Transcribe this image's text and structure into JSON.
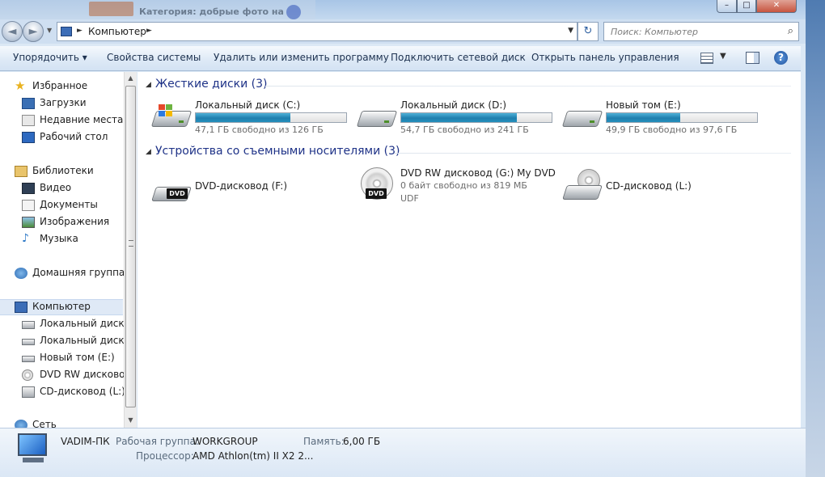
{
  "window": {
    "title_ghost": "Категория: добрые фото на",
    "minimize": "–",
    "maximize": "□",
    "close": "✕"
  },
  "nav": {
    "back": "◄",
    "forward": "►",
    "history": "▼",
    "address": "Компьютер",
    "refresh": "↻",
    "search_placeholder": "Поиск: Компьютер"
  },
  "commands": {
    "organize": "Упорядочить ▾",
    "system_props": "Свойства системы",
    "uninstall": "Удалить или изменить программу",
    "map_drive": "Подключить сетевой диск",
    "control_panel": "Открыть панель управления"
  },
  "navpane": {
    "items": [
      {
        "label": "Избранное"
      },
      {
        "label": "Загрузки"
      },
      {
        "label": "Недавние места"
      },
      {
        "label": "Рабочий стол"
      },
      {
        "label": "Библиотеки"
      },
      {
        "label": "Видео"
      },
      {
        "label": "Документы"
      },
      {
        "label": "Изображения"
      },
      {
        "label": "Музыка"
      },
      {
        "label": "Домашняя группа"
      },
      {
        "label": "Компьютер"
      },
      {
        "label": "Локальный диск (C"
      },
      {
        "label": "Локальный диск (D"
      },
      {
        "label": "Новый том (E:)"
      },
      {
        "label": "DVD RW дисковод ("
      },
      {
        "label": "CD-дисковод (L:)"
      },
      {
        "label": "Сеть"
      }
    ]
  },
  "content": {
    "hdd_group": "Жесткие диски (3)",
    "removable_group": "Устройства со съемными носителями (3)",
    "hdds": [
      {
        "name": "Локальный диск (C:)",
        "free": "47,1 ГБ свободно из 126 ГБ",
        "used_fraction": 0.63
      },
      {
        "name": "Локальный диск (D:)",
        "free": "54,7 ГБ свободно из 241 ГБ",
        "used_fraction": 0.77
      },
      {
        "name": "Новый том (E:)",
        "free": "49,9 ГБ свободно из 97,6 ГБ",
        "used_fraction": 0.49
      }
    ],
    "removables": [
      {
        "name": "DVD-дисковод (F:)",
        "line2": "",
        "line3": "",
        "badge": "DVD"
      },
      {
        "name": "DVD RW дисковод (G:) My DVD",
        "line2": "0 байт свободно из 819 МБ",
        "line3": "UDF",
        "badge": "DVD"
      },
      {
        "name": "CD-дисковод (L:)",
        "line2": "",
        "line3": "",
        "badge": ""
      }
    ]
  },
  "details": {
    "computer_name": "VADIM-ПК",
    "workgroup_label": "Рабочая группа:",
    "workgroup_value": "WORKGROUP",
    "memory_label": "Память:",
    "memory_value": "6,00 ГБ",
    "cpu_label": "Процессор:",
    "cpu_value": "AMD Athlon(tm) II X2 2..."
  },
  "colors": {
    "accent": "#1e3287",
    "bar_fill": "#1f7fae"
  }
}
